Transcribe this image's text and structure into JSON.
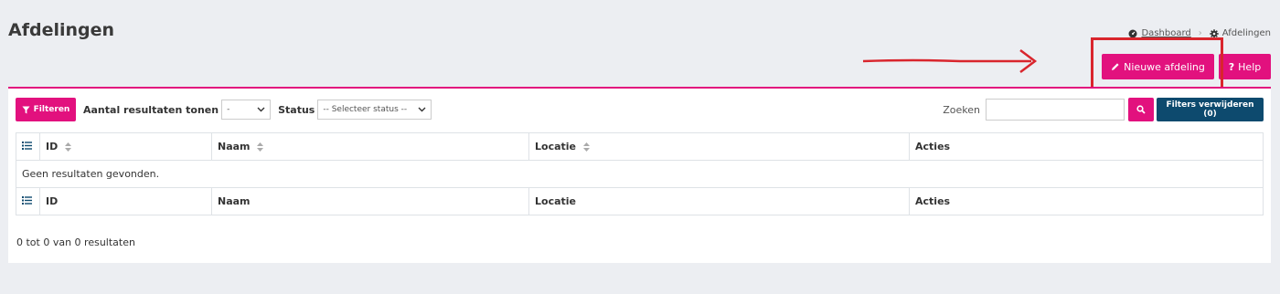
{
  "header": {
    "title": "Afdelingen",
    "breadcrumb": [
      {
        "label": "Dashboard",
        "icon": "dashboard-icon"
      },
      {
        "label": "Afdelingen",
        "icon": "gear-icon"
      }
    ]
  },
  "actions": {
    "new_label": "Nieuwe afdeling",
    "help_label": "Help"
  },
  "toolbar": {
    "filter_label": "Filteren",
    "page_size_label": "Aantal resultaten tonen",
    "page_size_value": "-",
    "status_label": "Status",
    "status_placeholder": "-- Selecteer status --",
    "search_label": "Zoeken",
    "search_value": "",
    "clear_label": "Filters verwijderen (0)"
  },
  "table": {
    "columns": [
      "ID",
      "Naam",
      "Locatie",
      "Acties"
    ],
    "empty_message": "Geen resultaten gevonden."
  },
  "footer": {
    "results_text": "0 tot 0 van 0 resultaten"
  },
  "colors": {
    "accent": "#e2117e",
    "secondary": "#0d4a6e",
    "annotation": "#d9252d"
  }
}
